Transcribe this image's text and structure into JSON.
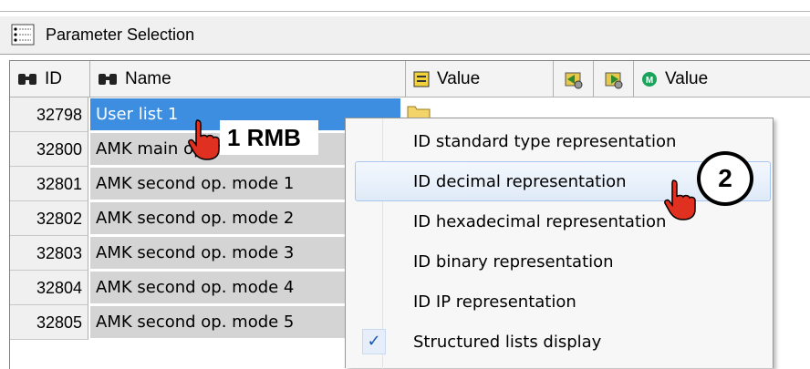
{
  "window": {
    "title": "Parameter Selection"
  },
  "table": {
    "columns": [
      {
        "label": "ID",
        "icon": "binoculars-icon"
      },
      {
        "label": "Name",
        "icon": "binoculars-icon"
      },
      {
        "label": "Value",
        "icon": "value-icon"
      },
      {
        "label": "",
        "icon": "download-arrow-icon"
      },
      {
        "label": "",
        "icon": "upload-arrow-icon"
      },
      {
        "label": "Value",
        "icon": "m-value-icon"
      }
    ],
    "rows": [
      {
        "id": "32798",
        "name": "User list 1",
        "selected": true
      },
      {
        "id": "32800",
        "name": "AMK main op. mode"
      },
      {
        "id": "32801",
        "name": "AMK second op. mode 1"
      },
      {
        "id": "32802",
        "name": "AMK second op. mode 2"
      },
      {
        "id": "32803",
        "name": "AMK second op. mode 3"
      },
      {
        "id": "32804",
        "name": "AMK second op. mode 4"
      },
      {
        "id": "32805",
        "name": "AMK second op. mode 5"
      }
    ]
  },
  "context_menu": {
    "items": [
      {
        "label": "ID standard type representation"
      },
      {
        "label": "ID decimal representation",
        "highlighted": true
      },
      {
        "label": "ID hexadecimal representation"
      },
      {
        "label": "ID binary representation"
      },
      {
        "label": "ID IP representation"
      },
      {
        "label": "Structured lists display",
        "checked": true
      }
    ]
  },
  "annotations": {
    "step1": "1 RMB",
    "step2": "2"
  },
  "colors": {
    "selection": "#3d8ee0",
    "name_bg": "#d4d4d4",
    "menu_bg": "#f7f7f7",
    "hover_border": "#a9c7ee"
  }
}
